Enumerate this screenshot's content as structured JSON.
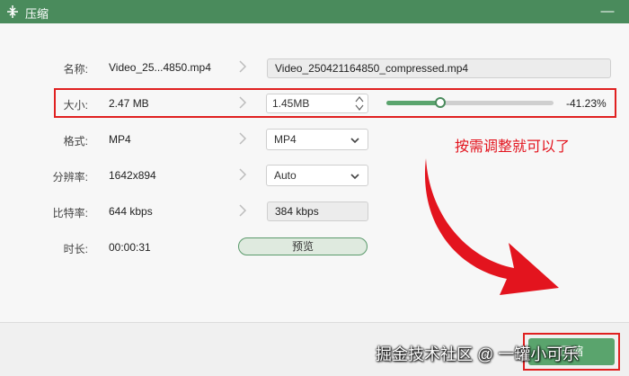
{
  "window": {
    "title": "压缩",
    "close_glyph": "—"
  },
  "rows": {
    "name": {
      "label": "名称:",
      "value": "Video_25...4850.mp4",
      "output": "Video_250421164850_compressed.mp4"
    },
    "size": {
      "label": "大小:",
      "value": "2.47 MB",
      "target": "1.45MB",
      "percent_text": "-41.23%",
      "slider_fraction": 0.32
    },
    "format": {
      "label": "格式:",
      "value": "MP4",
      "selected": "MP4"
    },
    "resolution": {
      "label": "分辨率:",
      "value": "1642x894",
      "selected": "Auto"
    },
    "bitrate": {
      "label": "比特率:",
      "value": "644 kbps",
      "output": "384 kbps"
    },
    "duration": {
      "label": "时长:",
      "value": "00:00:31",
      "preview_label": "预览"
    }
  },
  "annotation": {
    "text": "按需调整就可以了",
    "color": "#e3141e"
  },
  "footer": {
    "compress_label": "压缩"
  },
  "watermark": "掘金技术社区 @ 一罐小可乐",
  "colors": {
    "accent": "#4a8b5c",
    "highlight": "#e02020"
  },
  "icons": [
    "compress-icon",
    "minimize-icon",
    "chevron-right-icon",
    "caret-down-icon",
    "spin-up-icon",
    "spin-down-icon",
    "arrow-icon"
  ]
}
